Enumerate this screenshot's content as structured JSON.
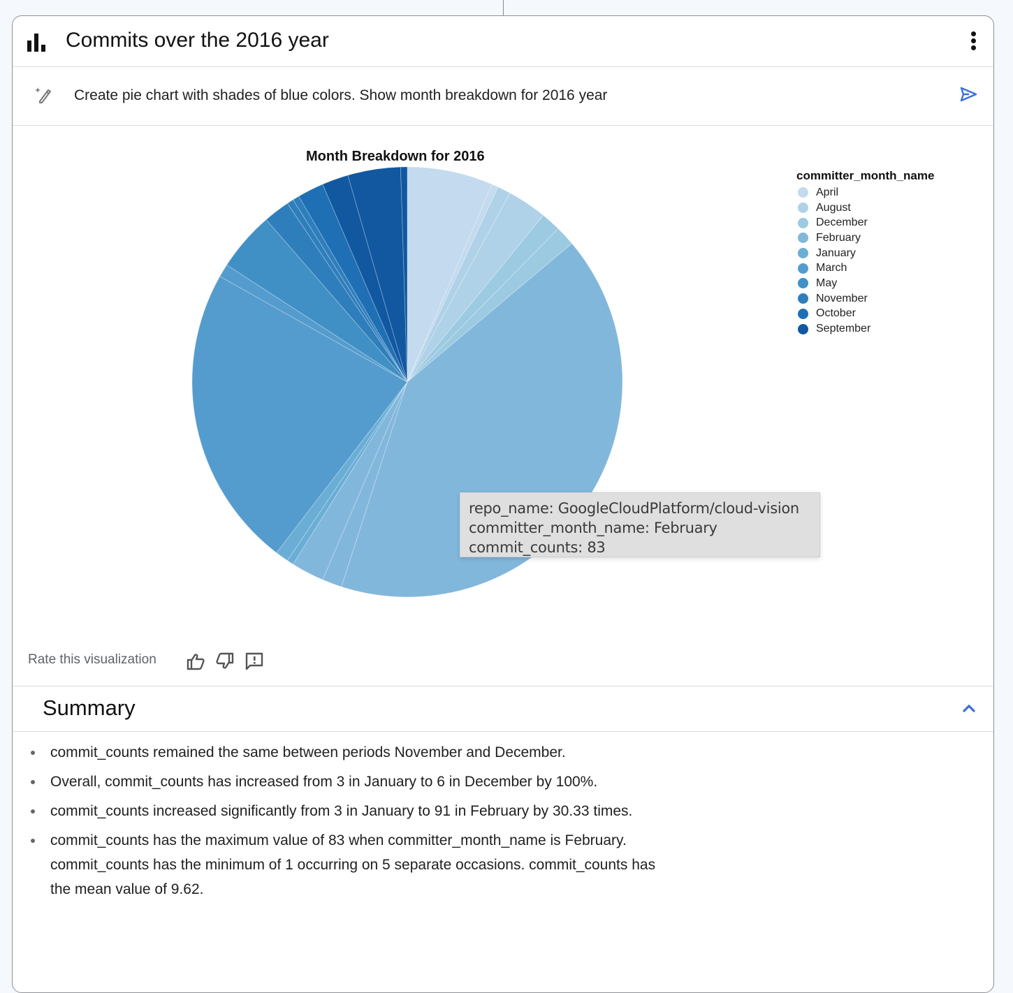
{
  "card": {
    "title": "Commits over the 2016 year",
    "title_icon": "bar-chart-icon",
    "menu_icon": "more-vert-icon"
  },
  "prompt": {
    "icon": "magic-wand-icon",
    "text": "Create pie chart with shades of blue colors. Show month breakdown for 2016 year",
    "send_icon": "send-icon",
    "send_color": "#3b6fd8"
  },
  "chart_data": {
    "type": "pie",
    "title": "Month Breakdown for 2016",
    "legend_title": "committer_month_name",
    "legend_position": "top-right",
    "value_field": "commit_counts",
    "categories": [
      "April",
      "August",
      "December",
      "February",
      "January",
      "March",
      "May",
      "November",
      "October",
      "September"
    ],
    "colors": {
      "April": "#c4daee",
      "August": "#b0d2e8",
      "December": "#9ccae1",
      "February": "#82b7dc",
      "January": "#6aaed6",
      "March": "#559cce",
      "May": "#4090c5",
      "November": "#2f7ebc",
      "October": "#1f6fb4",
      "September": "#1158a1"
    },
    "slices": [
      {
        "month": "April",
        "value": 13
      },
      {
        "month": "April",
        "value": 1
      },
      {
        "month": "August",
        "value": 2
      },
      {
        "month": "August",
        "value": 6
      },
      {
        "month": "December",
        "value": 3
      },
      {
        "month": "December",
        "value": 3
      },
      {
        "month": "February",
        "value": 83,
        "repo_name": "GoogleCloudPlatform/cloud-vision"
      },
      {
        "month": "February",
        "value": 3
      },
      {
        "month": "February",
        "value": 5
      },
      {
        "month": "January",
        "value": 1
      },
      {
        "month": "January",
        "value": 2
      },
      {
        "month": "March",
        "value": 46
      },
      {
        "month": "March",
        "value": 2
      },
      {
        "month": "May",
        "value": 9
      },
      {
        "month": "November",
        "value": 4
      },
      {
        "month": "November",
        "value": 1
      },
      {
        "month": "November",
        "value": 1
      },
      {
        "month": "October",
        "value": 4
      },
      {
        "month": "September",
        "value": 4
      },
      {
        "month": "September",
        "value": 8
      },
      {
        "month": "September",
        "value": 1
      }
    ],
    "tooltip": {
      "lines": [
        "repo_name: GoogleCloudPlatform/cloud-vision",
        "committer_month_name: February",
        "commit_counts: 83"
      ]
    }
  },
  "rating": {
    "label": "Rate this visualization",
    "icons": [
      "thumb-up-icon",
      "thumb-down-icon",
      "feedback-icon"
    ]
  },
  "summary": {
    "title": "Summary",
    "toggle_icon": "chevron-up-icon",
    "items": [
      "commit_counts remained the same between periods November and December.",
      "Overall, commit_counts has increased from 3 in January to 6 in December by 100%.",
      "commit_counts increased significantly from 3 in January to 91 in February by 30.33 times.",
      "commit_counts has the maximum value of 83 when committer_month_name is February. commit_counts has the minimum of 1 occurring on 5 separate occasions. commit_counts has the mean value of 9.62."
    ]
  }
}
